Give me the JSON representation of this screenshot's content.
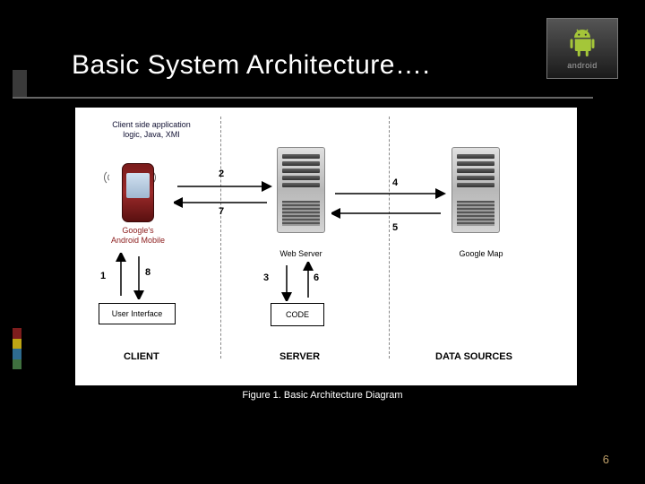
{
  "header": {
    "title": "Basic System Architecture….",
    "logo_text": "android"
  },
  "caption": "Figure 1. Basic Architecture Diagram",
  "page_number": "6",
  "diagram": {
    "client_text": "Client side application logic, Java, XMI",
    "phone_label": "Google's Android Mobile",
    "ui_box": "User Interface",
    "web_server_label": "Web Server",
    "code_box": "CODE",
    "zone_client": "CLIENT",
    "zone_server": "SERVER",
    "zone_data": "DATA SOURCES",
    "data_label": "Google Map",
    "steps": {
      "n1": "1",
      "n2": "2",
      "n3": "3",
      "n4": "4",
      "n5": "5",
      "n6": "6",
      "n7": "7",
      "n8": "8"
    }
  },
  "stripe_colors": [
    "#7d1d1d",
    "#bda514",
    "#2e6b8f",
    "#3f703f"
  ]
}
